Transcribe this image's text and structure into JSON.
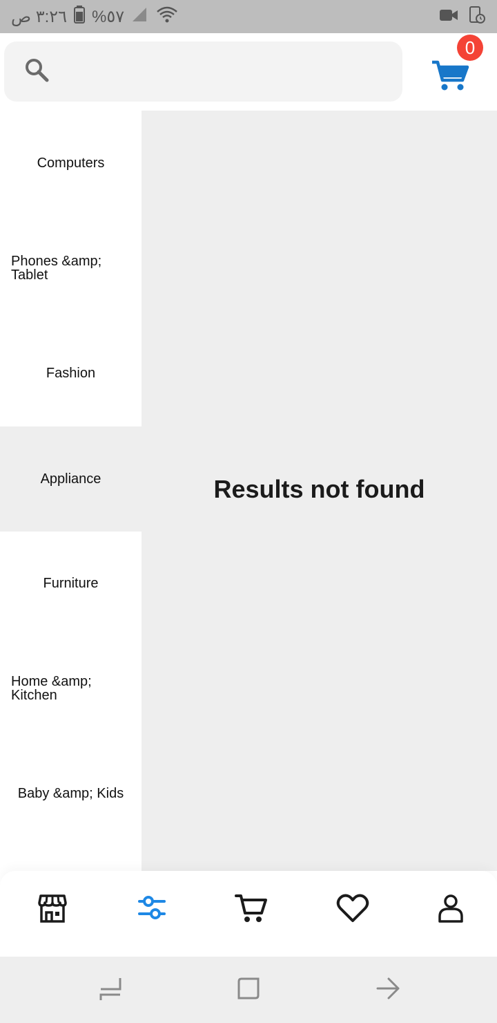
{
  "status_bar": {
    "time": "٣:٢٦ ص",
    "battery": "%٥٧"
  },
  "search": {
    "value": "",
    "placeholder": ""
  },
  "cart": {
    "count": "0"
  },
  "categories": [
    {
      "label": "Computers"
    },
    {
      "label": "Phones &amp; Tablet"
    },
    {
      "label": "Fashion"
    },
    {
      "label": "Appliance"
    },
    {
      "label": "Furniture"
    },
    {
      "label": "Home &amp; Kitchen"
    },
    {
      "label": "Baby &amp; Kids"
    }
  ],
  "selected_category": "Appliance",
  "content": {
    "empty_message": "Results not found"
  },
  "bottom_nav": {
    "items": [
      {
        "icon": "store-icon"
      },
      {
        "icon": "filter-icon",
        "active": true
      },
      {
        "icon": "cart-icon"
      },
      {
        "icon": "heart-icon"
      },
      {
        "icon": "user-icon"
      }
    ]
  },
  "colors": {
    "accent": "#1e88e5",
    "cart_icon": "#1877c9",
    "badge": "#f44336",
    "selected_bg": "#eeeeee"
  }
}
